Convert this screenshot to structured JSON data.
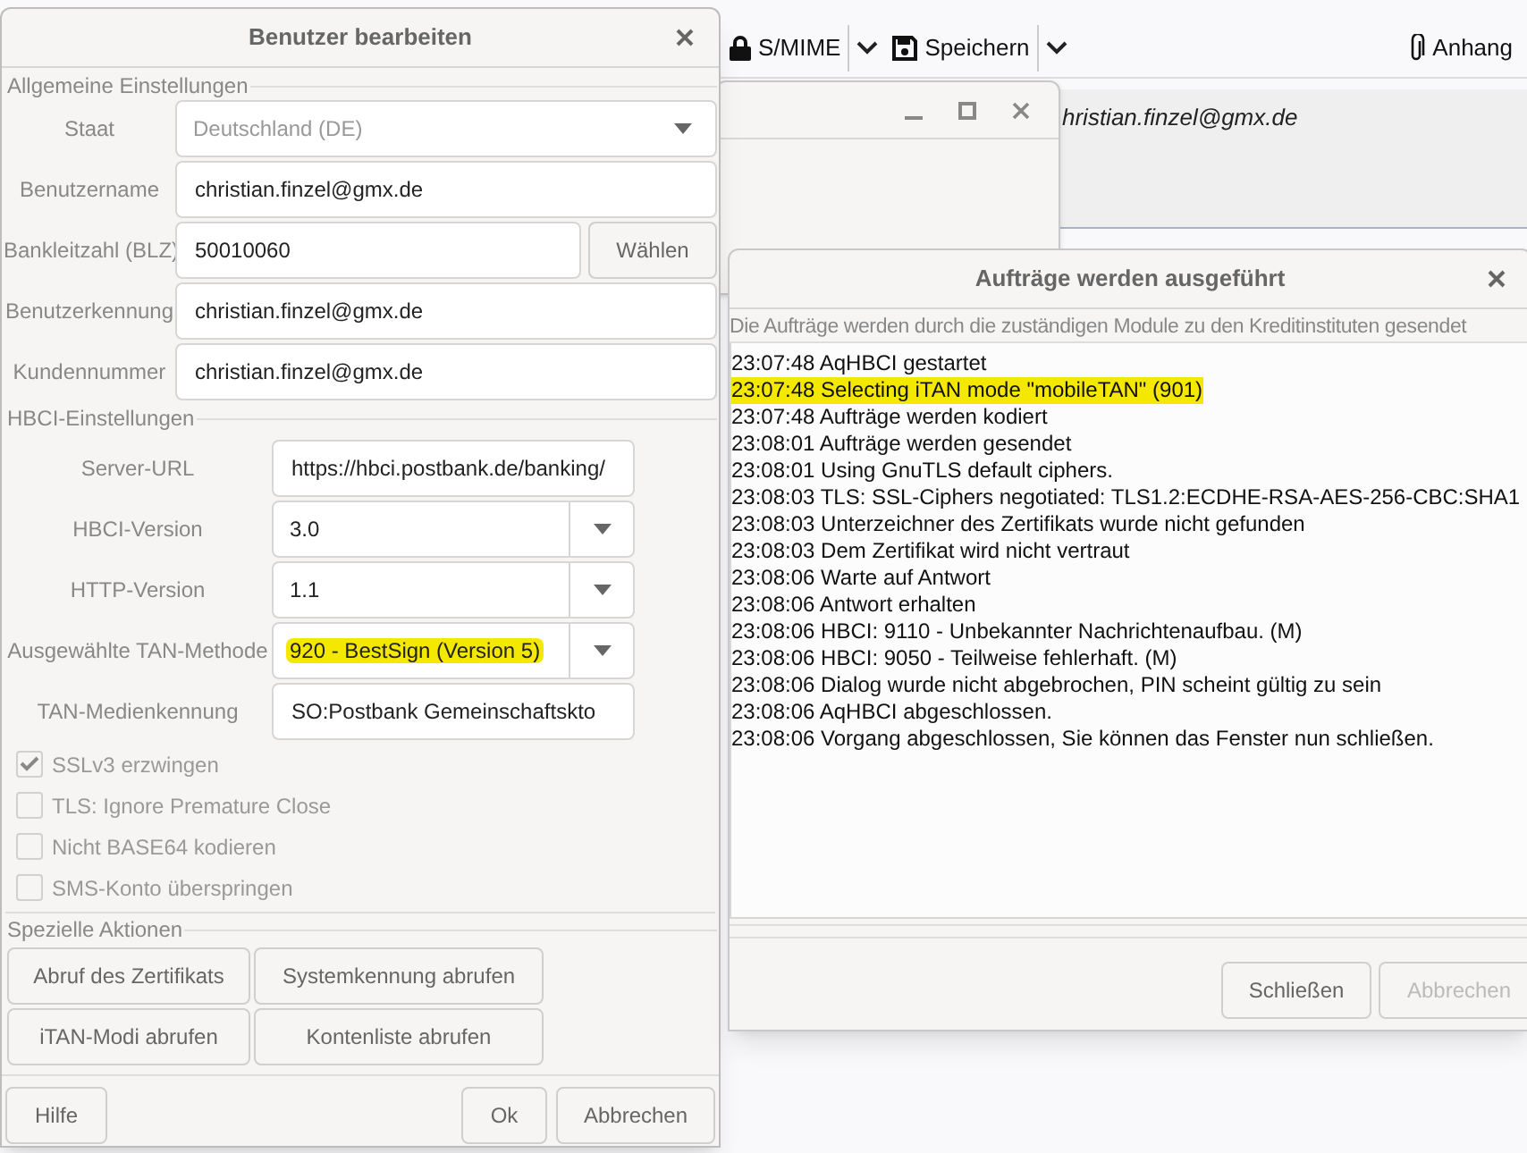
{
  "background_app": {
    "toolbar": [
      {
        "kind": "lock",
        "label": "S/MIME",
        "dropdown": true
      },
      {
        "kind": "save",
        "label": "Speichern",
        "dropdown": true
      },
      {
        "kind": "attach",
        "label": "Anhang",
        "dropdown": false
      }
    ],
    "sender": "hristian.finzel@gmx.de"
  },
  "edit_user_dialog": {
    "title": "Benutzer bearbeiten",
    "general": {
      "title": "Allgemeine Einstellungen",
      "fields": [
        {
          "kind": "combo",
          "label": "Staat",
          "value": "Deutschland (DE)",
          "disabled": true
        },
        {
          "kind": "input",
          "label": "Benutzername",
          "value": "christian.finzel@gmx.de"
        },
        {
          "kind": "input_button",
          "label": "Bankleitzahl (BLZ)",
          "value": "50010060",
          "button": "Wählen"
        },
        {
          "kind": "input",
          "label": "Benutzerkennung",
          "value": "christian.finzel@gmx.de"
        },
        {
          "kind": "input",
          "label": "Kundennummer",
          "value": "christian.finzel@gmx.de"
        }
      ]
    },
    "hbci": {
      "title": "HBCI-Einstellungen",
      "fields": [
        {
          "kind": "input",
          "label": "Server-URL",
          "value": "https://hbci.postbank.de/banking/",
          "highlighted": false
        },
        {
          "kind": "combo",
          "label": "HBCI-Version",
          "value": "3.0",
          "highlighted": false
        },
        {
          "kind": "combo",
          "label": "HTTP-Version",
          "value": "1.1",
          "highlighted": false
        },
        {
          "kind": "combo",
          "label": "Ausgewählte TAN-Methode",
          "value": "920 - BestSign (Version 5)",
          "highlighted": true
        },
        {
          "kind": "input",
          "label": "TAN-Medienkennung",
          "value": "SO:Postbank Gemeinschaftskto",
          "highlighted": false
        }
      ],
      "checkboxes": [
        {
          "label": "SSLv3 erzwingen",
          "checked": true
        },
        {
          "label": "TLS: Ignore Premature Close",
          "checked": false
        },
        {
          "label": "Nicht BASE64 kodieren",
          "checked": false
        },
        {
          "label": "SMS-Konto überspringen",
          "checked": false
        }
      ]
    },
    "actions": {
      "title": "Spezielle Aktionen",
      "buttons": [
        "Abruf des Zertifikats",
        "Systemkennung abrufen",
        "iTAN-Modi abrufen",
        "Kontenliste abrufen"
      ]
    },
    "buttons": [
      {
        "label": "Hilfe"
      },
      {
        "label": "Ok"
      },
      {
        "label": "Abbrechen"
      }
    ]
  },
  "progress_dialog": {
    "title": "Aufträge werden ausgeführt",
    "subtitle": "Die Aufträge werden durch die zuständigen Module zu den Kreditinstituten gesendet",
    "log": [
      {
        "text": "23:07:48 AqHBCI gestartet",
        "highlighted": false
      },
      {
        "text": "23:07:48 Selecting iTAN mode \"mobileTAN\" (901)",
        "highlighted": true
      },
      {
        "text": "23:07:48 Aufträge werden kodiert",
        "highlighted": false
      },
      {
        "text": "23:08:01 Aufträge werden gesendet",
        "highlighted": false
      },
      {
        "text": "23:08:01 Using GnuTLS default ciphers.",
        "highlighted": false
      },
      {
        "text": "23:08:03 TLS: SSL-Ciphers negotiated: TLS1.2:ECDHE-RSA-AES-256-CBC:SHA1",
        "highlighted": false
      },
      {
        "text": "23:08:03 Unterzeichner des Zertifikats wurde nicht gefunden",
        "highlighted": false
      },
      {
        "text": "23:08:03 Dem Zertifikat wird nicht vertraut",
        "highlighted": false
      },
      {
        "text": "23:08:06 Warte auf Antwort",
        "highlighted": false
      },
      {
        "text": "23:08:06 Antwort erhalten",
        "highlighted": false
      },
      {
        "text": "23:08:06 HBCI: 9110 - Unbekannter Nachrichtenaufbau. (M)",
        "highlighted": false
      },
      {
        "text": "23:08:06 HBCI: 9050 - Teilweise fehlerhaft. (M)",
        "highlighted": false
      },
      {
        "text": "23:08:06 Dialog wurde nicht abgebrochen, PIN scheint gültig zu sein",
        "highlighted": false
      },
      {
        "text": "23:08:06 AqHBCI abgeschlossen.",
        "highlighted": false
      },
      {
        "text": "23:08:06 Vorgang abgeschlossen, Sie können das Fenster nun schließen.",
        "highlighted": false
      }
    ],
    "progress": {
      "level": 0
    },
    "buttons": [
      {
        "label": "Schließen",
        "disabled": false
      },
      {
        "label": "Abbrechen",
        "disabled": true
      }
    ]
  }
}
